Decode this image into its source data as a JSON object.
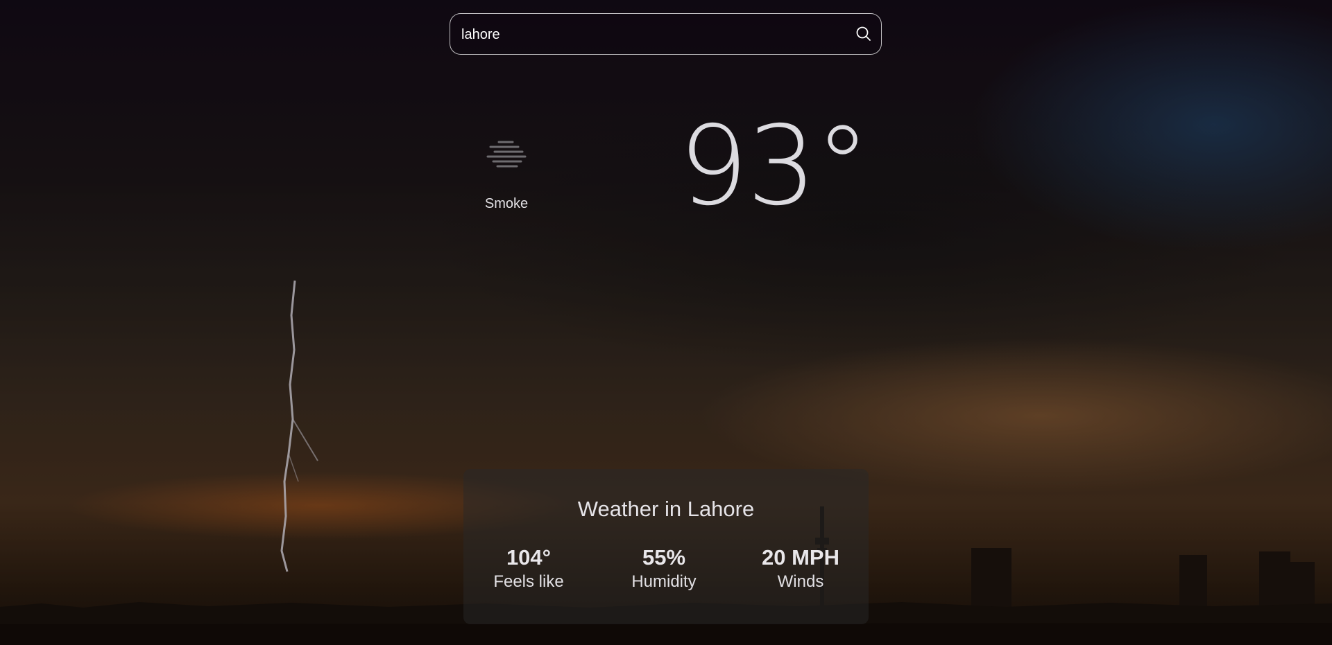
{
  "search": {
    "value": "lahore",
    "icon": "search-icon"
  },
  "current": {
    "temperature": "93°",
    "condition": "Smoke",
    "condition_icon": "smoke-icon"
  },
  "details": {
    "title": "Weather in Lahore",
    "stats": [
      {
        "value": "104°",
        "label": "Feels like"
      },
      {
        "value": "55%",
        "label": "Humidity"
      },
      {
        "value": "20 MPH",
        "label": "Winds"
      }
    ]
  }
}
